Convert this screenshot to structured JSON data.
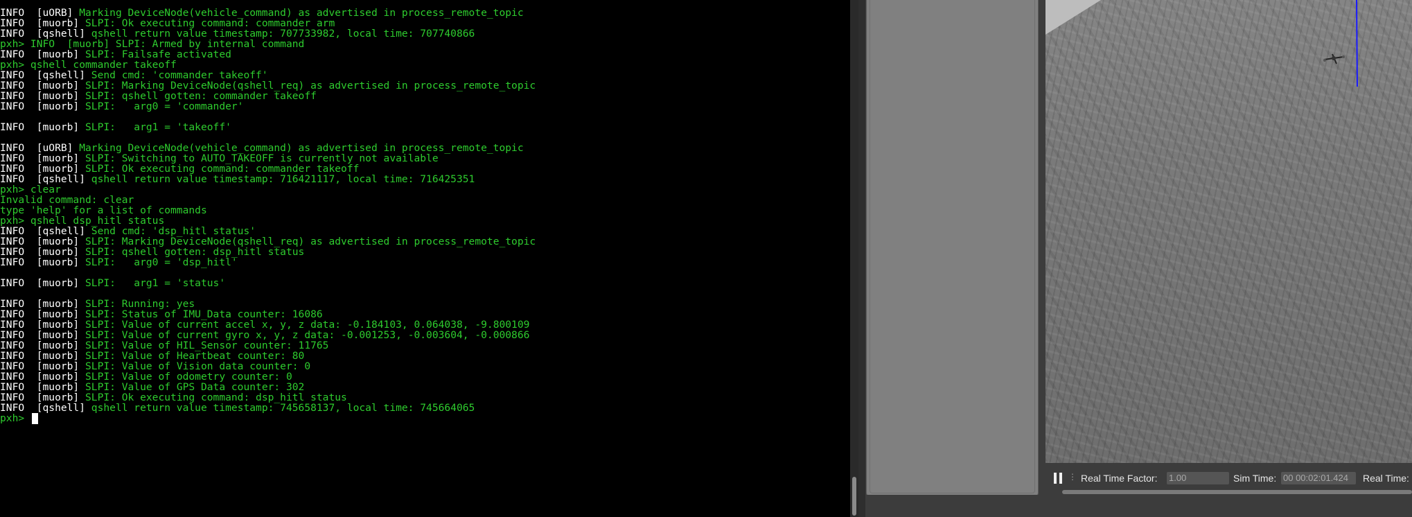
{
  "terminal": {
    "lines": [
      {
        "tag": "INFO  [uORB]",
        "msg": " Marking DeviceNode(vehicle_command) as advertised in process_remote_topic"
      },
      {
        "tag": "INFO  [muorb]",
        "msg": " SLPI: Ok executing command: commander arm"
      },
      {
        "tag": "INFO  [qshell]",
        "msg": " qshell return value timestamp: 707733982, local time: 707740866"
      },
      {
        "tag": "",
        "msg": "pxh> INFO  [muorb] SLPI: Armed by internal command"
      },
      {
        "tag": "INFO  [muorb]",
        "msg": " SLPI: Failsafe activated"
      },
      {
        "tag": "",
        "msg": "pxh> qshell commander takeoff"
      },
      {
        "tag": "INFO  [qshell]",
        "msg": " Send cmd: 'commander takeoff'"
      },
      {
        "tag": "INFO  [muorb]",
        "msg": " SLPI: Marking DeviceNode(qshell_req) as advertised in process_remote_topic"
      },
      {
        "tag": "INFO  [muorb]",
        "msg": " SLPI: qshell gotten: commander takeoff"
      },
      {
        "tag": "INFO  [muorb]",
        "msg": " SLPI:   arg0 = 'commander'"
      },
      {
        "tag": "",
        "msg": ""
      },
      {
        "tag": "INFO  [muorb]",
        "msg": " SLPI:   arg1 = 'takeoff'"
      },
      {
        "tag": "",
        "msg": ""
      },
      {
        "tag": "INFO  [uORB]",
        "msg": " Marking DeviceNode(vehicle_command) as advertised in process_remote_topic"
      },
      {
        "tag": "INFO  [muorb]",
        "msg": " SLPI: Switching to AUTO_TAKEOFF is currently not available"
      },
      {
        "tag": "INFO  [muorb]",
        "msg": " SLPI: Ok executing command: commander takeoff"
      },
      {
        "tag": "INFO  [qshell]",
        "msg": " qshell return value timestamp: 716421117, local time: 716425351"
      },
      {
        "tag": "",
        "msg": "pxh> clear"
      },
      {
        "tag": "",
        "msg": "Invalid command: clear"
      },
      {
        "tag": "",
        "msg": "type 'help' for a list of commands"
      },
      {
        "tag": "",
        "msg": "pxh> qshell dsp_hitl status"
      },
      {
        "tag": "INFO  [qshell]",
        "msg": " Send cmd: 'dsp_hitl status'"
      },
      {
        "tag": "INFO  [muorb]",
        "msg": " SLPI: Marking DeviceNode(qshell_req) as advertised in process_remote_topic"
      },
      {
        "tag": "INFO  [muorb]",
        "msg": " SLPI: qshell gotten: dsp_hitl status"
      },
      {
        "tag": "INFO  [muorb]",
        "msg": " SLPI:   arg0 = 'dsp_hitl'"
      },
      {
        "tag": "",
        "msg": ""
      },
      {
        "tag": "INFO  [muorb]",
        "msg": " SLPI:   arg1 = 'status'"
      },
      {
        "tag": "",
        "msg": ""
      },
      {
        "tag": "INFO  [muorb]",
        "msg": " SLPI: Running: yes"
      },
      {
        "tag": "INFO  [muorb]",
        "msg": " SLPI: Status of IMU_Data counter: 16086"
      },
      {
        "tag": "INFO  [muorb]",
        "msg": " SLPI: Value of current accel x, y, z data: -0.184103, 0.064038, -9.800109"
      },
      {
        "tag": "INFO  [muorb]",
        "msg": " SLPI: Value of current gyro x, y, z data: -0.001253, -0.003604, -0.000866"
      },
      {
        "tag": "INFO  [muorb]",
        "msg": " SLPI: Value of HIL_Sensor counter: 11765"
      },
      {
        "tag": "INFO  [muorb]",
        "msg": " SLPI: Value of Heartbeat counter: 80"
      },
      {
        "tag": "INFO  [muorb]",
        "msg": " SLPI: Value of Vision data counter: 0"
      },
      {
        "tag": "INFO  [muorb]",
        "msg": " SLPI: Value of odometry counter: 0"
      },
      {
        "tag": "INFO  [muorb]",
        "msg": " SLPI: Value of GPS Data counter: 302"
      },
      {
        "tag": "INFO  [muorb]",
        "msg": " SLPI: Ok executing command: dsp_hitl status"
      },
      {
        "tag": "INFO  [qshell]",
        "msg": " qshell return value timestamp: 745658137, local time: 745664065"
      }
    ],
    "prompt": "pxh> "
  },
  "gazebo": {
    "real_time_factor_label": "Real Time Factor:",
    "real_time_factor_value": "1.00",
    "sim_time_label": "Sim Time:",
    "sim_time_value": "00 00:02:01.424",
    "real_time_label": "Real Time:",
    "colors": {
      "ground": "#7a7a7a",
      "axis_line": "#1a1aff",
      "drone": "#222222"
    }
  },
  "colors": {
    "terminal_bg": "#000000",
    "terminal_text": "#2ecc2e",
    "terminal_tag": "#ffffff"
  }
}
